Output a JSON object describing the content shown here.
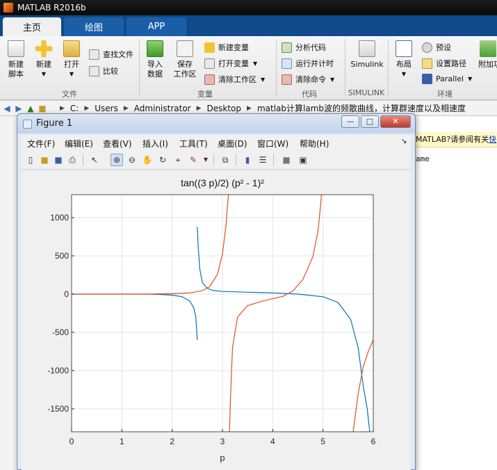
{
  "window": {
    "title": "MATLAB R2016b"
  },
  "tabs": [
    {
      "label": "主页"
    },
    {
      "label": "绘图"
    },
    {
      "label": "APP"
    }
  ],
  "ribbon": {
    "new_script": "新建\n脚本",
    "new": "新建",
    "open": "打开",
    "find_files": "查找文件",
    "compare": "比较",
    "import_data": "导入\n数据",
    "save_workspace": "保存\n工作区",
    "new_variable": "新建变量",
    "open_variable": "打开变量",
    "clear_workspace": "清除工作区",
    "analyze_code": "分析代码",
    "run_and_time": "运行并计时",
    "clear_commands": "清除命令",
    "simulink": "Simulink",
    "layout": "布局",
    "preferences": "预设",
    "set_path": "设置路径",
    "parallel": "Parallel",
    "addons": "附加功",
    "sections": {
      "file": "文件",
      "variable": "变量",
      "code": "代码",
      "simulink": "SIMULINK",
      "environment": "环境"
    }
  },
  "address": {
    "crumbs": [
      "C:",
      "Users",
      "Administrator",
      "Desktop",
      "matlab计算lamb波的频散曲线，计算群速度以及相速度"
    ]
  },
  "info_bar": {
    "text": "MATLAB?请参阅有关",
    "link": "快"
  },
  "command_snippet": "ame",
  "figure": {
    "title": "Figure 1",
    "menu": [
      "文件(F)",
      "编辑(E)",
      "查看(V)",
      "插入(I)",
      "工具(T)",
      "桌面(D)",
      "窗口(W)",
      "帮助(H)"
    ],
    "buttons": {
      "minimize": "—",
      "maximize": "□",
      "close": "✕"
    }
  },
  "chart_data": {
    "type": "line",
    "title": "tan((3 p)/2) (p² - 1)²",
    "xlabel": "p",
    "ylabel": "",
    "xlim": [
      0,
      6
    ],
    "ylim": [
      -1800,
      1300
    ],
    "xticks": [
      0,
      1,
      2,
      3,
      4,
      5,
      6
    ],
    "yticks": [
      1000,
      500,
      0,
      -500,
      -1000,
      -1500
    ],
    "grid": true,
    "series": [
      {
        "color": "#0072BD",
        "segments": [
          {
            "x": [
              0,
              0.5,
              1.0,
              1.5,
              1.8,
              2.0,
              2.2,
              2.35,
              2.43,
              2.47,
              2.5
            ],
            "y": [
              0,
              0,
              0,
              0,
              -5,
              -14,
              -35,
              -90,
              -180,
              -300,
              -600
            ]
          },
          {
            "x": [
              2.5,
              2.52,
              2.55,
              2.6,
              2.7,
              2.8,
              3.0,
              3.5,
              4.0,
              4.5,
              5.0,
              5.3,
              5.55,
              5.7,
              5.8,
              5.88,
              5.93
            ],
            "y": [
              880,
              600,
              330,
              150,
              75,
              50,
              35,
              25,
              15,
              0,
              -35,
              -110,
              -330,
              -700,
              -1200,
              -1500,
              -1800
            ]
          }
        ]
      },
      {
        "color": "#D95319",
        "segments": [
          {
            "x": [
              0,
              0.5,
              1.0,
              1.5,
              2.0,
              2.2,
              2.4,
              2.6,
              2.75,
              2.9,
              3.0,
              3.07,
              3.1,
              3.12
            ],
            "y": [
              0,
              0,
              0,
              0,
              5,
              10,
              20,
              45,
              100,
              260,
              520,
              900,
              1150,
              1300
            ]
          },
          {
            "x": [
              3.14,
              3.16,
              3.2,
              3.3,
              3.5,
              3.8,
              4.0,
              4.2,
              4.4,
              4.6,
              4.8,
              4.9,
              4.95,
              4.97
            ],
            "y": [
              -1800,
              -1350,
              -700,
              -300,
              -150,
              -90,
              -60,
              -30,
              40,
              190,
              490,
              820,
              1150,
              1300
            ]
          },
          {
            "x": [
              5.6,
              5.7,
              5.8,
              5.9,
              6.0
            ],
            "y": [
              -1800,
              -1300,
              -950,
              -750,
              -600
            ]
          }
        ]
      }
    ]
  }
}
